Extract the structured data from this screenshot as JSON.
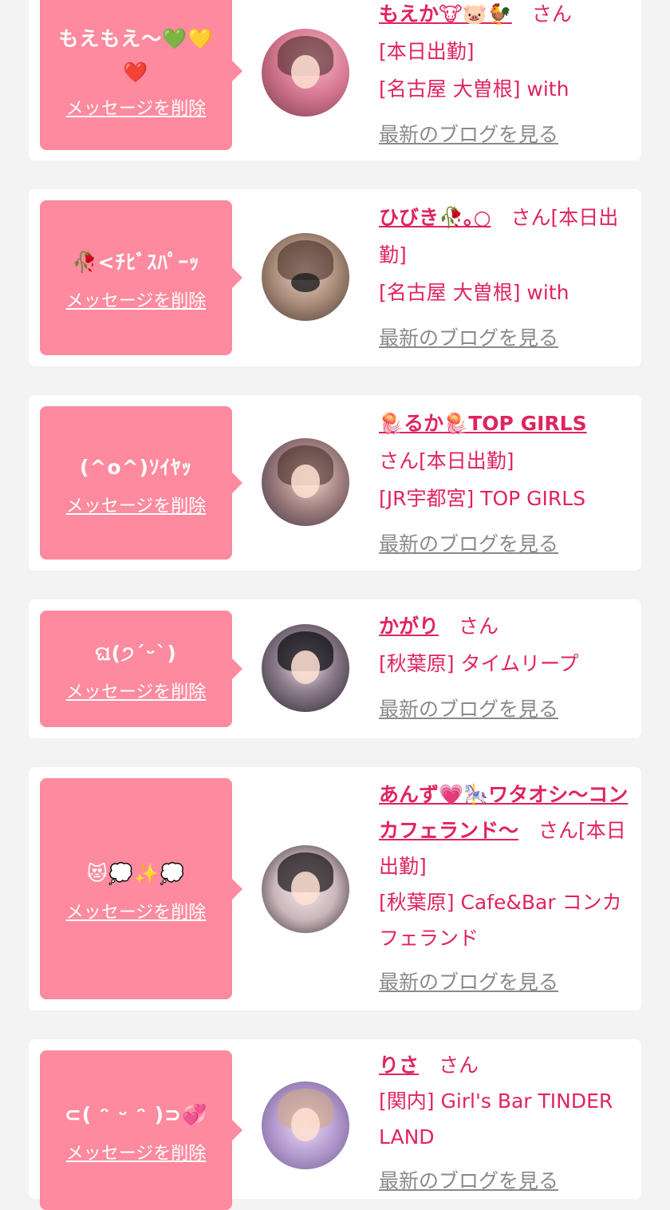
{
  "colors": {
    "accent": "#e0245e",
    "bubble": "#fd8a9e",
    "card": "#ffffff",
    "background": "#f3f3f3",
    "link_gray": "#8a8a8a"
  },
  "delete_label": "メッセージを削除",
  "blog_label": "最新のブログを見る",
  "entries": [
    {
      "message": "もえもえ〜💚💛❤️",
      "name": "もえか🐮🐷🐓",
      "san": "さん",
      "status": "[本日出勤]",
      "location": "[名古屋 大曽根] with"
    },
    {
      "message": "🥀<ﾁﾋﾞｽﾊﾟｰｯ",
      "name": "ひびき🥀｡○",
      "san": "さん[本日出勤]",
      "status": "",
      "location": "[名古屋 大曽根] with"
    },
    {
      "message": "(^o^)ｿｲﾔｯ",
      "name": "🪼るか🪼TOP GIRLS",
      "san": "さん[本日出勤]",
      "status": "",
      "location": "[JR宇都宮] TOP GIRLS"
    },
    {
      "message": "ଘ(੭ˊᵕˋ)",
      "name": "かがり",
      "san": "さん",
      "status": "",
      "location": "[秋葉原] タイムリープ"
    },
    {
      "message": "😻💭✨💭",
      "name": "あんず💗🎠ワタオシ〜コンカフェランド〜",
      "san": "さん[本日出勤]",
      "status": "",
      "location": "[秋葉原] Cafe&Bar コンカフェランド"
    },
    {
      "message": "⊂( ᵔ ᵕ ᵔ )⊃💞",
      "name": "りさ",
      "san": "さん",
      "status": "",
      "location": "[関内] Girl's Bar TINDER LAND"
    }
  ]
}
